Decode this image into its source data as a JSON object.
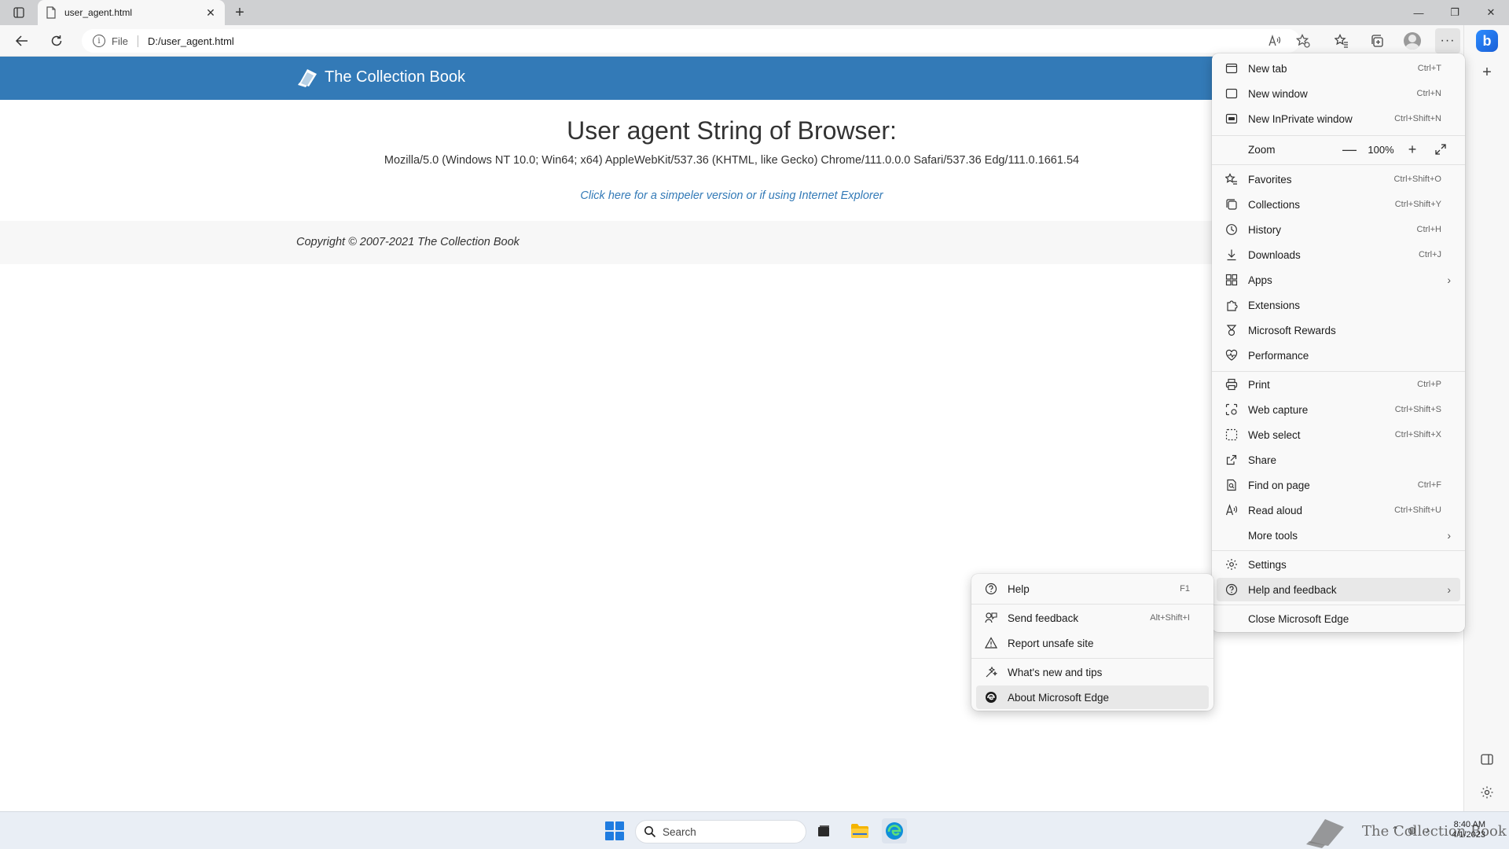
{
  "browser": {
    "tab": {
      "title": "user_agent.html"
    },
    "address": {
      "scheme": "File",
      "url": "D:/user_agent.html"
    }
  },
  "site": {
    "brand": "The Collection Book",
    "heading": "User agent String of Browser:",
    "ua_string": "Mozilla/5.0 (Windows NT 10.0; Win64; x64) AppleWebKit/537.36 (KHTML, like Gecko) Chrome/111.0.0.0 Safari/537.36 Edg/111.0.1661.54",
    "link_text": "Click here for a simpeler version or if using Internet Explorer",
    "copyright": "Copyright © 2007-2021 The Collection Book",
    "header_color": "#337ab7"
  },
  "menu": {
    "items": [
      {
        "label": "New tab",
        "shortcut": "Ctrl+T",
        "icon": "new-tab-icon"
      },
      {
        "label": "New window",
        "shortcut": "Ctrl+N",
        "icon": "new-window-icon"
      },
      {
        "label": "New InPrivate window",
        "shortcut": "Ctrl+Shift+N",
        "icon": "inprivate-icon"
      },
      {
        "label": "Zoom",
        "value": "100%"
      },
      {
        "label": "Favorites",
        "shortcut": "Ctrl+Shift+O",
        "icon": "favorites-icon"
      },
      {
        "label": "Collections",
        "shortcut": "Ctrl+Shift+Y",
        "icon": "collections-icon"
      },
      {
        "label": "History",
        "shortcut": "Ctrl+H",
        "icon": "history-icon"
      },
      {
        "label": "Downloads",
        "shortcut": "Ctrl+J",
        "icon": "downloads-icon"
      },
      {
        "label": "Apps",
        "icon": "apps-icon"
      },
      {
        "label": "Extensions",
        "icon": "extensions-icon"
      },
      {
        "label": "Microsoft Rewards",
        "icon": "rewards-icon"
      },
      {
        "label": "Performance",
        "icon": "performance-icon"
      },
      {
        "label": "Print",
        "shortcut": "Ctrl+P",
        "icon": "print-icon"
      },
      {
        "label": "Web capture",
        "shortcut": "Ctrl+Shift+S",
        "icon": "web-capture-icon"
      },
      {
        "label": "Web select",
        "shortcut": "Ctrl+Shift+X",
        "icon": "web-select-icon"
      },
      {
        "label": "Share",
        "icon": "share-icon"
      },
      {
        "label": "Find on page",
        "shortcut": "Ctrl+F",
        "icon": "find-icon"
      },
      {
        "label": "Read aloud",
        "shortcut": "Ctrl+Shift+U",
        "icon": "read-aloud-icon"
      },
      {
        "label": "More tools"
      },
      {
        "label": "Settings",
        "icon": "settings-icon"
      },
      {
        "label": "Help and feedback",
        "icon": "help-icon"
      },
      {
        "label": "Close Microsoft Edge"
      }
    ]
  },
  "submenu": {
    "items": [
      {
        "label": "Help",
        "shortcut": "F1",
        "icon": "help-icon"
      },
      {
        "label": "Send feedback",
        "shortcut": "Alt+Shift+I",
        "icon": "feedback-icon"
      },
      {
        "label": "Report unsafe site",
        "icon": "warning-icon"
      },
      {
        "label": "What's new and tips",
        "icon": "tips-icon"
      },
      {
        "label": "About Microsoft Edge",
        "icon": "edge-icon"
      }
    ]
  },
  "taskbar": {
    "search_placeholder": "Search",
    "watermark": "The Collection Book",
    "time": "8:40 AM",
    "date": "4/1/2023"
  }
}
